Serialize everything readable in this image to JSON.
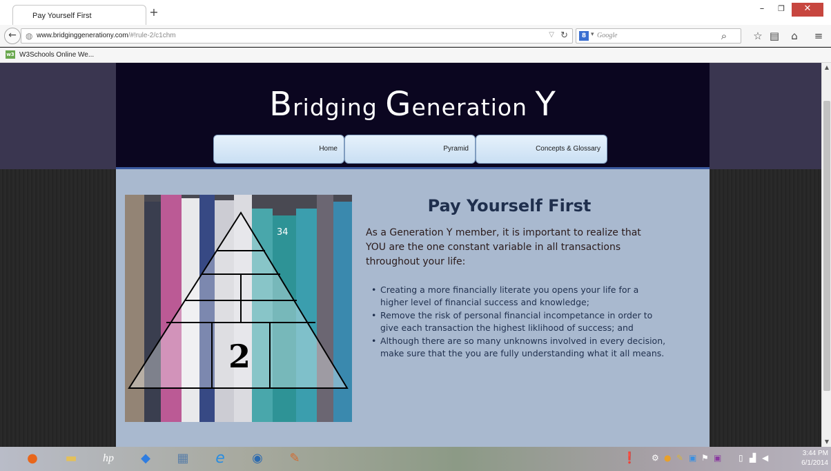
{
  "browser": {
    "tab_title": "Pay Yourself First",
    "new_tab_symbol": "+",
    "url_domain": "www.bridginggenerationy.com",
    "url_path": "/#!rule-2/c1chm",
    "search_placeholder": "Google",
    "search_engine": "8",
    "bookmark_label": "W3Schools Online We...",
    "bookmark_icon_text": "w3"
  },
  "site": {
    "title_prefix_big": "B",
    "title_part1": "ridging ",
    "title_big2": "G",
    "title_part2": "eneration ",
    "title_big3": "Y",
    "nav": {
      "home": "Home",
      "pyramid": "Pyramid",
      "concepts": "Concepts & Glossary"
    }
  },
  "content": {
    "heading": "Pay Yourself First",
    "intro": "As a Generation Y member, it is important to realize that YOU are the one constant variable in all transactions throughout your life:",
    "bullets": [
      "Creating a more financially literate you opens your life for a higher level of financial success and knowledge;",
      "Remove the risk of personal financial incompetance in order to give each transaction the highest liklihood of success; and",
      "Although there are so many unknowns involved in every decision, make sure that the you are fully understanding what it all means."
    ],
    "pyramid_number": "2",
    "book_spine_number": "34"
  },
  "taskbar": {
    "time": "3:44 PM",
    "date": "6/1/2014",
    "apps": [
      "firefox-icon",
      "file-explorer-icon",
      "hp-icon",
      "rocket-icon",
      "calculator-icon",
      "internet-explorer-icon",
      "network-globe-icon",
      "paint-icon"
    ]
  },
  "colors": {
    "header_bg": "#0b0620",
    "content_bg": "#a9b9cf",
    "heading": "#1f2f4d",
    "side_band": "#3a3650"
  }
}
